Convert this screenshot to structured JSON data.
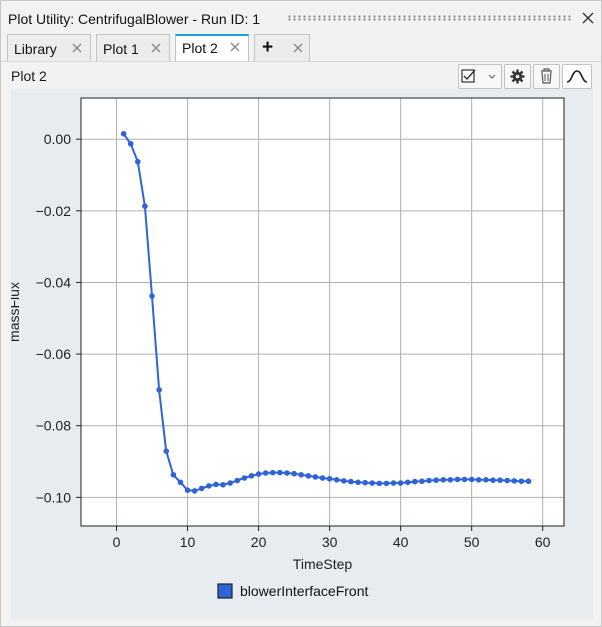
{
  "window": {
    "title": "Plot Utility: CentrifugalBlower - Run ID: 1"
  },
  "tabs": [
    {
      "label": "Library",
      "active": false
    },
    {
      "label": "Plot 1",
      "active": false
    },
    {
      "label": "Plot 2",
      "active": true
    },
    {
      "label": "+",
      "active": false
    }
  ],
  "toolbar": {
    "plot_name": "Plot 2",
    "icons": [
      "checklist-dropdown-icon",
      "gear-icon",
      "trash-icon",
      "curve-icon"
    ]
  },
  "colors": {
    "series": "#2f64d6",
    "accent": "#1aa0d8",
    "pane": "#e6ecef"
  },
  "chart_data": {
    "type": "line",
    "xlabel": "TimeStep",
    "ylabel": "massFlux",
    "xlim": [
      -5,
      63
    ],
    "ylim": [
      -0.108,
      0.0115
    ],
    "xticks": [
      0,
      10,
      20,
      30,
      40,
      50,
      60
    ],
    "yticks": [
      0.0,
      -0.02,
      -0.04,
      -0.06,
      -0.08,
      -0.1
    ],
    "xtick_labels": [
      "0",
      "10",
      "20",
      "30",
      "40",
      "50",
      "60"
    ],
    "ytick_labels": [
      "0.00",
      "−0.02",
      "−0.04",
      "−0.06",
      "−0.08",
      "−0.10"
    ],
    "grid": true,
    "legend_position": "bottom-center",
    "series": [
      {
        "name": "blowerInterfaceFront",
        "color": "#2f64d6",
        "x": [
          1,
          2,
          3,
          4,
          5,
          6,
          7,
          8,
          9,
          10,
          11,
          12,
          13,
          14,
          15,
          16,
          17,
          18,
          19,
          20,
          21,
          22,
          23,
          24,
          25,
          26,
          27,
          28,
          29,
          30,
          31,
          32,
          33,
          34,
          35,
          36,
          37,
          38,
          39,
          40,
          41,
          42,
          43,
          44,
          45,
          46,
          47,
          48,
          49,
          50,
          51,
          52,
          53,
          54,
          55,
          56,
          57,
          58
        ],
        "y": [
          0.0015,
          -0.0013,
          -0.0063,
          -0.0187,
          -0.0438,
          -0.07,
          -0.0871,
          -0.0937,
          -0.0958,
          -0.098,
          -0.0982,
          -0.0975,
          -0.0968,
          -0.0964,
          -0.0965,
          -0.096,
          -0.0953,
          -0.0946,
          -0.094,
          -0.0935,
          -0.0932,
          -0.0931,
          -0.0931,
          -0.0932,
          -0.0934,
          -0.0937,
          -0.094,
          -0.0943,
          -0.0946,
          -0.0948,
          -0.0951,
          -0.0954,
          -0.0956,
          -0.0958,
          -0.0959,
          -0.096,
          -0.0961,
          -0.0961,
          -0.096,
          -0.096,
          -0.0958,
          -0.0956,
          -0.0955,
          -0.0953,
          -0.0952,
          -0.0951,
          -0.0951,
          -0.095,
          -0.095,
          -0.095,
          -0.0951,
          -0.0951,
          -0.0952,
          -0.0952,
          -0.0953,
          -0.0954,
          -0.0955,
          -0.0955
        ]
      }
    ]
  }
}
